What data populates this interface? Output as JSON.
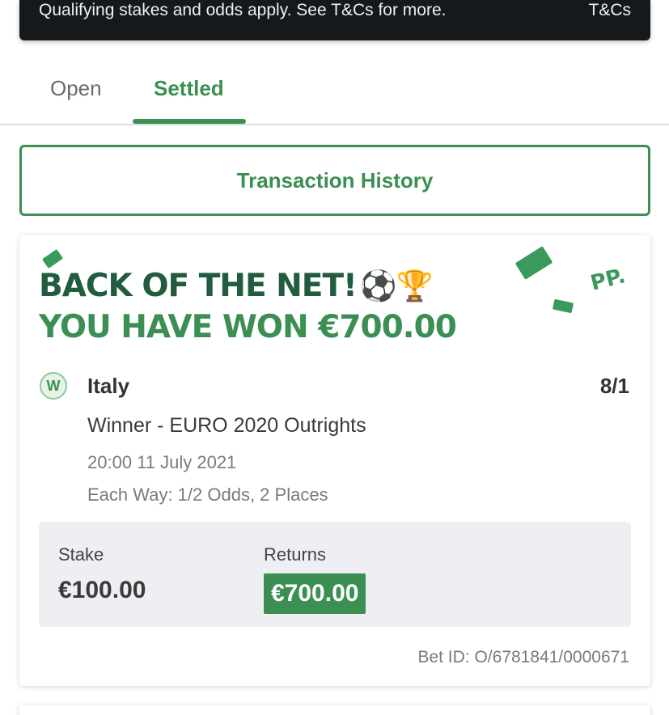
{
  "promo": {
    "message": "Qualifying stakes and odds apply. See T&Cs for more.",
    "tc_link": "T&Cs"
  },
  "tabs": [
    {
      "label": "Open",
      "active": false
    },
    {
      "label": "Settled",
      "active": true
    }
  ],
  "transaction_history_label": "Transaction History",
  "bet": {
    "headline_line1": "BACK OF THE NET!",
    "headline_emoji": "⚽🏆",
    "headline_line2": "YOU HAVE WON €700.00",
    "brand_mark": "PP.",
    "result_badge": "W",
    "selection": "Italy",
    "odds": "8/1",
    "market": "Winner - EURO 2020 Outrights",
    "datetime": "20:00 11 July 2021",
    "each_way": "Each Way: 1/2 Odds, 2 Places",
    "stake_label": "Stake",
    "stake_value": "€100.00",
    "returns_label": "Returns",
    "returns_value": "€700.00",
    "bet_id": "Bet ID: O/6781841/0000671"
  },
  "colors": {
    "brand_green": "#3b8f52",
    "dark_green": "#215c3e",
    "banner_bg": "#16191b"
  }
}
